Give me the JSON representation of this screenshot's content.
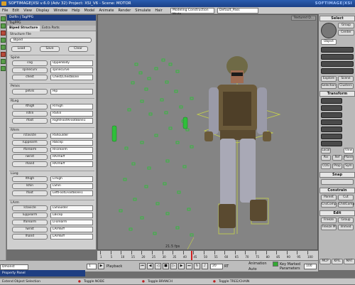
{
  "window": {
    "title": "SOFTIMAGE|XSI v.6.0 (Adv 32) Project: XSI_V6 - Scene: MOTOR",
    "brand": "SOFTIMAGE|XSI"
  },
  "menubar": {
    "items": [
      "File",
      "Edit",
      "View",
      "Display",
      "Window",
      "Help",
      "Model",
      "Animate",
      "Render",
      "Simulate",
      "Hair"
    ],
    "mode_dropdown": "Modeling Construction Mode",
    "pass_dropdown": "Default_Pass"
  },
  "panel": {
    "header": "Dolfin | TagPPG",
    "subheader": "TagPPG",
    "tabs": [
      "Biped Structure",
      "Extra Parts"
    ],
    "structure_file_label": "Structure File",
    "structure_file_value": "Biped",
    "actions": [
      "Load",
      "Save",
      "Clear"
    ],
    "groups": [
      {
        "title": "Spine",
        "rows": [
          {
            "button": "cog",
            "value": "UpperBody"
          },
          {
            "button": "spinecurv",
            "value": "spinecurve"
          },
          {
            "button": "chest",
            "value": "Chest|ChestBone"
          }
        ]
      },
      {
        "title": "Pelvis",
        "rows": [
          {
            "button": "pelvis",
            "value": "Hip"
          }
        ]
      },
      {
        "title": "RLeg",
        "rows": [
          {
            "button": "rthigh",
            "value": "RThigh"
          },
          {
            "button": "rshin",
            "value": "RShin"
          },
          {
            "button": "rfoot",
            "value": "RightFootRFootBone1"
          }
        ]
      },
      {
        "title": "RArm",
        "rows": [
          {
            "button": "rclavicle",
            "value": "RShoulder"
          },
          {
            "button": "ruppearm",
            "value": "RBicep"
          },
          {
            "button": "rforearm",
            "value": "RForearm"
          },
          {
            "button": "rwrist",
            "value": "RArmEff"
          },
          {
            "button": "rhand",
            "value": "RArmEff"
          }
        ]
      },
      {
        "title": "LLeg",
        "rows": [
          {
            "button": "lthigh",
            "value": "LThigh"
          },
          {
            "button": "lshin",
            "value": "LShin"
          },
          {
            "button": "lfoot",
            "value": "LeftFootLFootBone1"
          }
        ]
      },
      {
        "title": "LArm",
        "rows": [
          {
            "button": "lclavicle",
            "value": "LShoulder"
          },
          {
            "button": "luppearm",
            "value": "LBicep"
          },
          {
            "button": "lforearm",
            "value": "LForearm"
          },
          {
            "button": "lwrist",
            "value": "LArmEff"
          },
          {
            "button": "lhand",
            "value": "LArmEff"
          }
        ]
      }
    ]
  },
  "viewport": {
    "tab": "Textured D...",
    "fps": "21.5 fps"
  },
  "right_panel": {
    "select_header": "Select",
    "group_btn": "Group",
    "center_btn": "Center",
    "object_btn": "Object",
    "explore_btn": "Explore",
    "scene_btn": "Scene",
    "selection_btn": "Selection",
    "clusters_btn": "Clusters",
    "transform_header": "Transform",
    "cog_btn": "COG",
    "prop_btn": "Prop",
    "sym_btn": "Sym",
    "view_btn": "View",
    "par_btn": "Par",
    "ref_btn": "Ref",
    "plane_btn": "Plane",
    "local_btn": "Local",
    "snap_header": "Snap",
    "constrain_header": "Constrain",
    "parent_btn": "Parent",
    "cut_btn": "Cut",
    "cnscomp_btn": "CnsComp",
    "chldcomp_btn": "ChldComp",
    "edit_header": "Edit",
    "freeze_btn": "Freeze",
    "group2_btn": "Group",
    "freezem_btn": "Freeze M",
    "immed_btn": "Immed",
    "footer": [
      "MCP",
      "KP/L",
      "MAT"
    ]
  },
  "timeline": {
    "ticks": [
      "1",
      "5",
      "10",
      "15",
      "20",
      "25",
      "30",
      "35",
      "40",
      "45",
      "50",
      "55",
      "60",
      "65",
      "70",
      "75",
      "80",
      "85",
      "90",
      "95",
      "100"
    ]
  },
  "playbar": {
    "start_field": "1",
    "playback_label": "Playback",
    "frame_field": "20",
    "rt_label": "RT",
    "animation_label": "Animation",
    "auto_label": "Auto",
    "key_marked_label": "Key Marked Parameters",
    "end_field": "100"
  },
  "property_panel_tab": "Property Panel",
  "current_name": "Dmonst",
  "status": {
    "left": "Extend Object Selection",
    "m1": "Toggle NODE",
    "m2": "Toggle BRANCH",
    "m3": "Toggle TREE/CHAIN"
  }
}
